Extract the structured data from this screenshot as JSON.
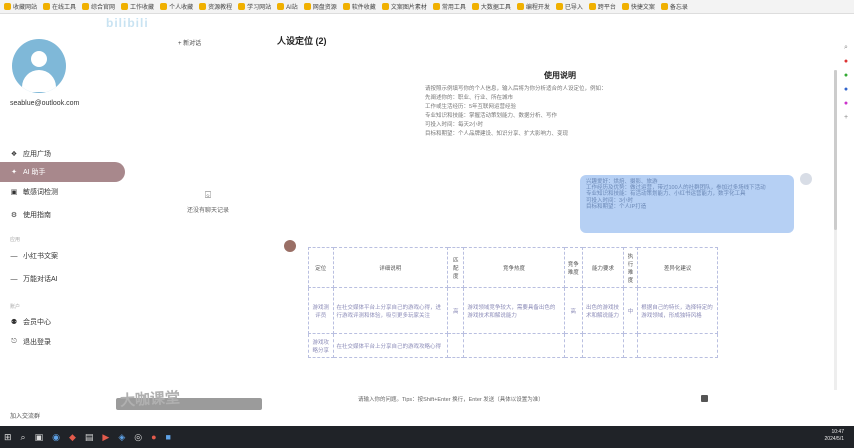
{
  "bookmarks": [
    {
      "label": "收藏网站"
    },
    {
      "label": "在线工具"
    },
    {
      "label": "综合官网"
    },
    {
      "label": "工作收藏"
    },
    {
      "label": "个人收藏"
    },
    {
      "label": "资源教程"
    },
    {
      "label": "学习网站"
    },
    {
      "label": "AI站"
    },
    {
      "label": "网盘资源"
    },
    {
      "label": "软件收藏"
    },
    {
      "label": "文案图片素材"
    },
    {
      "label": "常用工具"
    },
    {
      "label": "大数据工具"
    },
    {
      "label": "编程开发"
    },
    {
      "label": "已导入"
    },
    {
      "label": "跨平台"
    },
    {
      "label": "快捷文案"
    },
    {
      "label": "备忘录"
    }
  ],
  "brand_overlay": "bilibili",
  "sidebar": {
    "email": "seablue@outlook.com",
    "nav": [
      {
        "label": "应用广场",
        "icon": "store-icon"
      },
      {
        "label": "AI 助手",
        "icon": "chat-icon"
      },
      {
        "label": "敏感词检测",
        "icon": "shield-icon"
      },
      {
        "label": "使用指南",
        "icon": "book-icon"
      }
    ],
    "section_app": "应用",
    "apps": [
      {
        "label": "小红书文案",
        "icon": "app-icon"
      },
      {
        "label": "万能对话AI",
        "icon": "app-icon"
      }
    ],
    "section_account": "账户",
    "account": [
      {
        "label": "会员中心",
        "icon": "crown-icon"
      },
      {
        "label": "退出登录",
        "icon": "logout-icon"
      }
    ],
    "bottom_text": "加入交流群"
  },
  "conversation": {
    "new_label": "新对话",
    "empty_text": "还没有聊天记录"
  },
  "main": {
    "title": "人设定位 (2)",
    "usage_title": "使用说明",
    "usage_lines": [
      "请按照示例填写你的个人信息，输入后将为你分析适合的人设定位，例如：",
      "先阐述你的：职业、行业、所在城市",
      "工作或生活经历：5年互联网运营经验",
      "专业知识和技能：掌握活动策划能力、数据分析、写作",
      "可投入时间：每天2小时",
      "目标和期望：个人品牌建设、知识分享、扩大影响力、变现"
    ],
    "user_lines": [
      "兴趣爱好：烘焙、摄影、旅游",
      "工作经历及优势：做过运营，带过100人的社群团队，参加过多场线下活动",
      "专业知识和技能：有活动策划能力、小红书运营能力，数字化工具",
      "可投入时间：3小时",
      "目标和期望：个人IP打造"
    ],
    "table": {
      "headers": [
        "定位",
        "详细说明",
        "匹配度",
        "竞争热度",
        "竞争难度",
        "能力要求",
        "执行难度",
        "差异化建议"
      ],
      "rows": [
        [
          "游戏测评员",
          "在社交媒体平台上分享自己的游戏心得，进行游戏评测和体验，吸引更多玩家关注",
          "高",
          "游戏领域竞争较大，需要具备出色的游戏技术和解说能力",
          "高",
          "出色的游戏技术和解说能力",
          "中",
          "根据自己的特长，选择特定的游戏领域，形成独特风格"
        ],
        [
          "游戏攻略分享",
          "在社交媒体平台上分享自己的游戏攻略心得",
          "",
          "",
          "",
          "",
          "",
          ""
        ]
      ]
    },
    "input_hint": "请输入你的问题。Tips：按Shift+Enter 换行，Enter 发送（具体以设置为准）",
    "watermark": "大咖课堂"
  },
  "taskbar": {
    "time": "10:47",
    "date": "2024/5/1"
  }
}
